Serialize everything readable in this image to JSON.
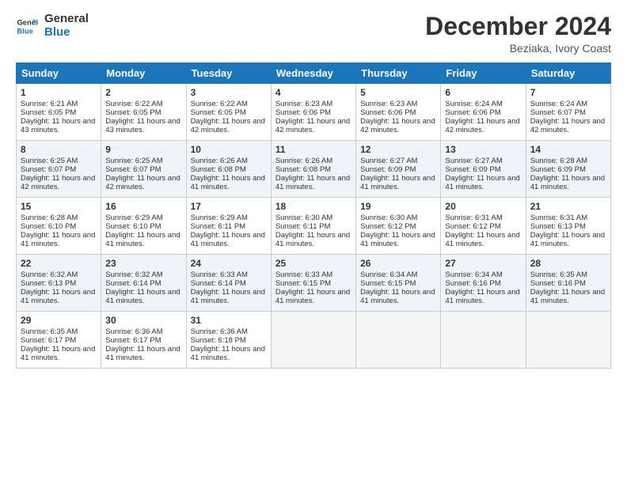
{
  "logo": {
    "line1": "General",
    "line2": "Blue"
  },
  "title": "December 2024",
  "location": "Beziaka, Ivory Coast",
  "days_header": [
    "Sunday",
    "Monday",
    "Tuesday",
    "Wednesday",
    "Thursday",
    "Friday",
    "Saturday"
  ],
  "weeks": [
    [
      {
        "day": "1",
        "sunrise": "Sunrise: 6:21 AM",
        "sunset": "Sunset: 6:05 PM",
        "daylight": "Daylight: 11 hours and 43 minutes."
      },
      {
        "day": "2",
        "sunrise": "Sunrise: 6:22 AM",
        "sunset": "Sunset: 6:05 PM",
        "daylight": "Daylight: 11 hours and 43 minutes."
      },
      {
        "day": "3",
        "sunrise": "Sunrise: 6:22 AM",
        "sunset": "Sunset: 6:05 PM",
        "daylight": "Daylight: 11 hours and 42 minutes."
      },
      {
        "day": "4",
        "sunrise": "Sunrise: 6:23 AM",
        "sunset": "Sunset: 6:06 PM",
        "daylight": "Daylight: 11 hours and 42 minutes."
      },
      {
        "day": "5",
        "sunrise": "Sunrise: 6:23 AM",
        "sunset": "Sunset: 6:06 PM",
        "daylight": "Daylight: 11 hours and 42 minutes."
      },
      {
        "day": "6",
        "sunrise": "Sunrise: 6:24 AM",
        "sunset": "Sunset: 6:06 PM",
        "daylight": "Daylight: 11 hours and 42 minutes."
      },
      {
        "day": "7",
        "sunrise": "Sunrise: 6:24 AM",
        "sunset": "Sunset: 6:07 PM",
        "daylight": "Daylight: 11 hours and 42 minutes."
      }
    ],
    [
      {
        "day": "8",
        "sunrise": "Sunrise: 6:25 AM",
        "sunset": "Sunset: 6:07 PM",
        "daylight": "Daylight: 11 hours and 42 minutes."
      },
      {
        "day": "9",
        "sunrise": "Sunrise: 6:25 AM",
        "sunset": "Sunset: 6:07 PM",
        "daylight": "Daylight: 11 hours and 42 minutes."
      },
      {
        "day": "10",
        "sunrise": "Sunrise: 6:26 AM",
        "sunset": "Sunset: 6:08 PM",
        "daylight": "Daylight: 11 hours and 41 minutes."
      },
      {
        "day": "11",
        "sunrise": "Sunrise: 6:26 AM",
        "sunset": "Sunset: 6:08 PM",
        "daylight": "Daylight: 11 hours and 41 minutes."
      },
      {
        "day": "12",
        "sunrise": "Sunrise: 6:27 AM",
        "sunset": "Sunset: 6:09 PM",
        "daylight": "Daylight: 11 hours and 41 minutes."
      },
      {
        "day": "13",
        "sunrise": "Sunrise: 6:27 AM",
        "sunset": "Sunset: 6:09 PM",
        "daylight": "Daylight: 11 hours and 41 minutes."
      },
      {
        "day": "14",
        "sunrise": "Sunrise: 6:28 AM",
        "sunset": "Sunset: 6:09 PM",
        "daylight": "Daylight: 11 hours and 41 minutes."
      }
    ],
    [
      {
        "day": "15",
        "sunrise": "Sunrise: 6:28 AM",
        "sunset": "Sunset: 6:10 PM",
        "daylight": "Daylight: 11 hours and 41 minutes."
      },
      {
        "day": "16",
        "sunrise": "Sunrise: 6:29 AM",
        "sunset": "Sunset: 6:10 PM",
        "daylight": "Daylight: 11 hours and 41 minutes."
      },
      {
        "day": "17",
        "sunrise": "Sunrise: 6:29 AM",
        "sunset": "Sunset: 6:11 PM",
        "daylight": "Daylight: 11 hours and 41 minutes."
      },
      {
        "day": "18",
        "sunrise": "Sunrise: 6:30 AM",
        "sunset": "Sunset: 6:11 PM",
        "daylight": "Daylight: 11 hours and 41 minutes."
      },
      {
        "day": "19",
        "sunrise": "Sunrise: 6:30 AM",
        "sunset": "Sunset: 6:12 PM",
        "daylight": "Daylight: 11 hours and 41 minutes."
      },
      {
        "day": "20",
        "sunrise": "Sunrise: 6:31 AM",
        "sunset": "Sunset: 6:12 PM",
        "daylight": "Daylight: 11 hours and 41 minutes."
      },
      {
        "day": "21",
        "sunrise": "Sunrise: 6:31 AM",
        "sunset": "Sunset: 6:13 PM",
        "daylight": "Daylight: 11 hours and 41 minutes."
      }
    ],
    [
      {
        "day": "22",
        "sunrise": "Sunrise: 6:32 AM",
        "sunset": "Sunset: 6:13 PM",
        "daylight": "Daylight: 11 hours and 41 minutes."
      },
      {
        "day": "23",
        "sunrise": "Sunrise: 6:32 AM",
        "sunset": "Sunset: 6:14 PM",
        "daylight": "Daylight: 11 hours and 41 minutes."
      },
      {
        "day": "24",
        "sunrise": "Sunrise: 6:33 AM",
        "sunset": "Sunset: 6:14 PM",
        "daylight": "Daylight: 11 hours and 41 minutes."
      },
      {
        "day": "25",
        "sunrise": "Sunrise: 6:33 AM",
        "sunset": "Sunset: 6:15 PM",
        "daylight": "Daylight: 11 hours and 41 minutes."
      },
      {
        "day": "26",
        "sunrise": "Sunrise: 6:34 AM",
        "sunset": "Sunset: 6:15 PM",
        "daylight": "Daylight: 11 hours and 41 minutes."
      },
      {
        "day": "27",
        "sunrise": "Sunrise: 6:34 AM",
        "sunset": "Sunset: 6:16 PM",
        "daylight": "Daylight: 11 hours and 41 minutes."
      },
      {
        "day": "28",
        "sunrise": "Sunrise: 6:35 AM",
        "sunset": "Sunset: 6:16 PM",
        "daylight": "Daylight: 11 hours and 41 minutes."
      }
    ],
    [
      {
        "day": "29",
        "sunrise": "Sunrise: 6:35 AM",
        "sunset": "Sunset: 6:17 PM",
        "daylight": "Daylight: 11 hours and 41 minutes."
      },
      {
        "day": "30",
        "sunrise": "Sunrise: 6:36 AM",
        "sunset": "Sunset: 6:17 PM",
        "daylight": "Daylight: 11 hours and 41 minutes."
      },
      {
        "day": "31",
        "sunrise": "Sunrise: 6:36 AM",
        "sunset": "Sunset: 6:18 PM",
        "daylight": "Daylight: 11 hours and 41 minutes."
      },
      null,
      null,
      null,
      null
    ]
  ]
}
